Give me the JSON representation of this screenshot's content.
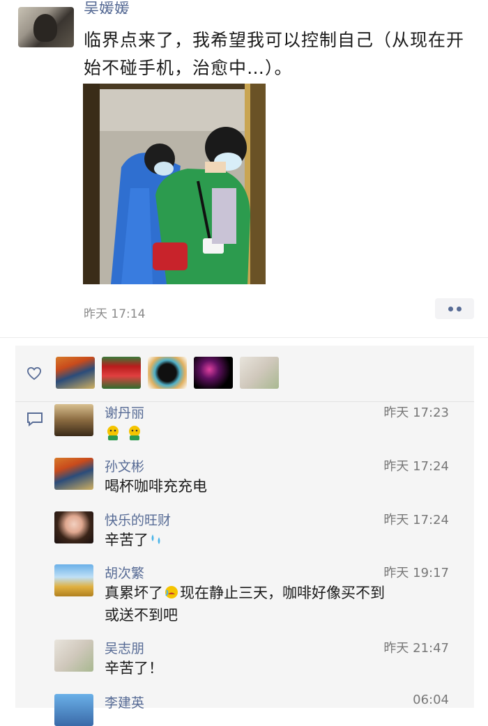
{
  "post": {
    "author": "吴媛媛",
    "text": "临界点来了，我希望我可以控制自己（从现在开始不碰手机，治愈中…）。",
    "time": "昨天 17:14"
  },
  "likes": {
    "avatars": [
      "scream-painting-avatar",
      "red-carpet-avatar",
      "mask-avatar",
      "neon-avatar",
      "bird-painting-avatar"
    ]
  },
  "comments": [
    {
      "name": "谢丹丽",
      "time": "昨天 17:23",
      "text": "",
      "emojis": [
        "grin",
        "grin"
      ]
    },
    {
      "name": "孙文彬",
      "time": "昨天 17:24",
      "text": "喝杯咖啡充充电"
    },
    {
      "name": "快乐的旺财",
      "time": "昨天 17:24",
      "text": "辛苦了",
      "emojis": [
        "sweat"
      ]
    },
    {
      "name": "胡次繁",
      "time": "昨天 19:17",
      "text_a": "真累坏了",
      "text_b": "现在静止三天，咖啡好像买不到",
      "text_c": "或送不到吧",
      "emojis": [
        "sad"
      ]
    },
    {
      "name": "吴志朋",
      "time": "昨天 21:47",
      "text": "辛苦了！"
    },
    {
      "name": "李建英",
      "time": "06:04",
      "text": ""
    }
  ],
  "colors": {
    "link": "#576b95",
    "panel": "#f5f5f5",
    "time": "#8a8a8a"
  }
}
